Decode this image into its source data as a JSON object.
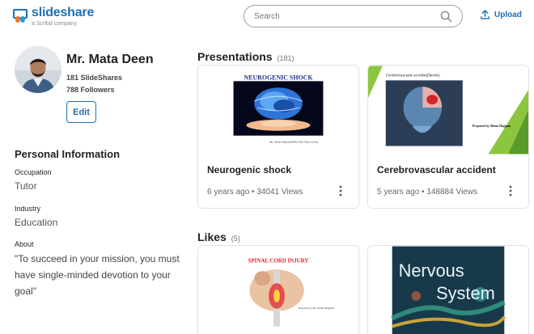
{
  "header": {
    "logo_name": "slideshare",
    "logo_sub": "a Scribd company",
    "search_placeholder": "Search",
    "upload_label": "Upload"
  },
  "profile": {
    "name": "Mr. Mata Deen",
    "slideshares": "181 SlideShares",
    "followers": "788 Followers",
    "edit_label": "Edit"
  },
  "personal": {
    "title": "Personal Information",
    "occupation_label": "Occupation",
    "occupation": "Tutor",
    "industry_label": "Industry",
    "industry": "Education",
    "about_label": "About",
    "about": "\"To succeed in your mission, you must have single-minded devotion to your goal\""
  },
  "presentations": {
    "title": "Presentations",
    "count": "(181)",
    "items": [
      {
        "title": "Neurogenic shock",
        "meta": "6 years ago • 34041 Views",
        "slide_heading": "NEUROGENIC SHOCK",
        "slide_caption": "Mr. Abbas Hajjami(SBS) MSc Nsg 1st year"
      },
      {
        "title": "Cerebrovascular accident",
        "meta": "5 years ago • 148884 Views",
        "slide_heading": "Cerebrovascular accident(Stroke)",
        "slide_caption": "Prepared by Abbas Hajjami"
      }
    ]
  },
  "likes": {
    "title": "Likes",
    "count": "(5)",
    "items": [
      {
        "slide_heading": "SPINAL CORD INJURY",
        "slide_caption": "Prepared by Mr. Abbas Hajjami"
      },
      {
        "slide_heading_1": "Nervous",
        "slide_heading_2": "System"
      }
    ]
  },
  "colors": {
    "brand_blue": "#1f6fb5",
    "logo_orange": "#e8792b",
    "slide_green": "#8cc63f",
    "slide_red": "#e11b22"
  }
}
